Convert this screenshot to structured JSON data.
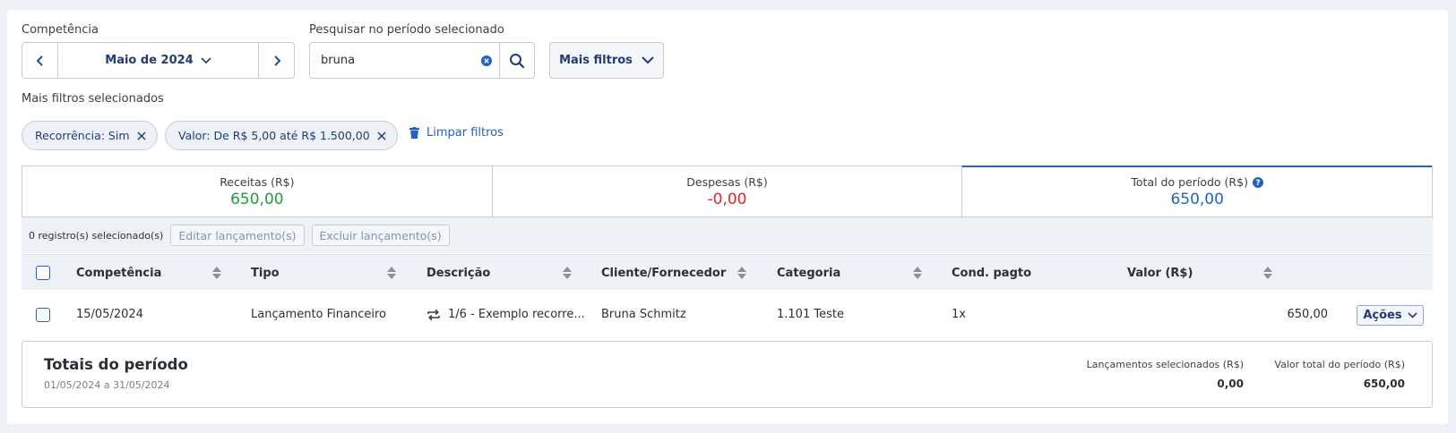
{
  "filters": {
    "competencia_label": "Competência",
    "month_label": "Maio de 2024",
    "search_label": "Pesquisar no período selecionado",
    "search_value": "bruna",
    "more_filters_button": "Mais filtros",
    "selected_filters_label": "Mais filtros selecionados",
    "chips": [
      {
        "label": "Recorrência: Sim"
      },
      {
        "label": "Valor: De R$ 5,00 até R$ 1.500,00"
      }
    ],
    "clear_filters": "Limpar filtros"
  },
  "summary": {
    "receitas": {
      "title": "Receitas (R$)",
      "value": "650,00",
      "color": "#1e9e3a"
    },
    "despesas": {
      "title": "Despesas (R$)",
      "value": "-0,00",
      "color": "#e0262b"
    },
    "total": {
      "title": "Total do período (R$)",
      "value": "650,00",
      "color": "#1f63c7"
    }
  },
  "toolbar": {
    "selected_count": "0 registro(s) selecionado(s)",
    "edit_button": "Editar lançamento(s)",
    "delete_button": "Excluir lançamento(s)"
  },
  "table": {
    "headers": {
      "competencia": "Competência",
      "tipo": "Tipo",
      "descricao": "Descrição",
      "cliente": "Cliente/Fornecedor",
      "categoria": "Categoria",
      "cond": "Cond. pagto",
      "valor": "Valor (R$)"
    },
    "rows": [
      {
        "competencia": "15/05/2024",
        "tipo": "Lançamento Financeiro",
        "descricao": "1/6 - Exemplo recorre...",
        "cliente": "Bruna Schmitz",
        "categoria": "1.101 Teste",
        "cond": "1x",
        "valor": "650,00",
        "acoes": "Ações"
      }
    ]
  },
  "totals": {
    "title": "Totais do período",
    "range": "01/05/2024 a 31/05/2024",
    "selected_label": "Lançamentos selecionados (R$)",
    "selected_value": "0,00",
    "total_label": "Valor total do período (R$)",
    "total_value": "650,00"
  }
}
